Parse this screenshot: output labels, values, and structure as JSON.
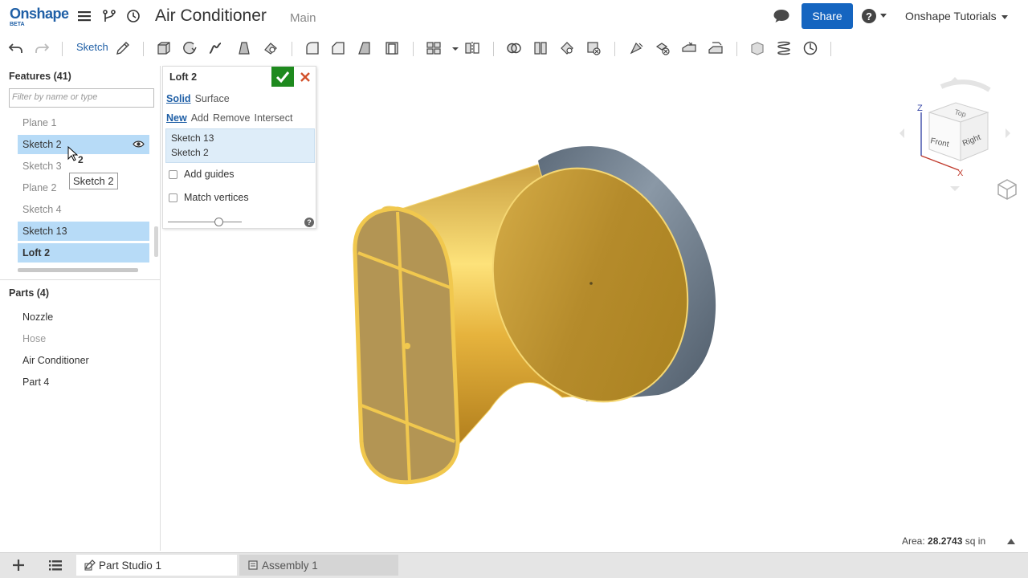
{
  "header": {
    "logo": "Onshape",
    "logo_badge": "BETA",
    "document_title": "Air Conditioner",
    "workspace": "Main",
    "share_label": "Share",
    "account_label": "Onshape Tutorials"
  },
  "toolbar": {
    "sketch_label": "Sketch"
  },
  "features": {
    "title": "Features (41)",
    "filter_placeholder": "Filter by name or type",
    "items": [
      {
        "label": "Plane 1"
      },
      {
        "label": "Sketch 2"
      },
      {
        "label": "Sketch 3"
      },
      {
        "label": "Plane 2"
      },
      {
        "label": "Sketch 4"
      },
      {
        "label": "Sketch 13"
      },
      {
        "label": "Loft 2"
      }
    ],
    "drag_count": "2",
    "tooltip": "Sketch 2"
  },
  "parts": {
    "title": "Parts (4)",
    "items": [
      {
        "label": "Nozzle"
      },
      {
        "label": "Hose"
      },
      {
        "label": "Air Conditioner"
      },
      {
        "label": "Part 4"
      }
    ]
  },
  "dialog": {
    "title": "Loft 2",
    "type_options": [
      "Solid",
      "Surface"
    ],
    "op_options": [
      "New",
      "Add",
      "Remove",
      "Intersect"
    ],
    "profiles": [
      "Sketch 13",
      "Sketch 2"
    ],
    "add_guides": "Add guides",
    "match_vertices": "Match vertices",
    "help": "?"
  },
  "viewcube": {
    "axis_z": "Z",
    "axis_x": "X",
    "face_top": "Top",
    "face_front": "Front",
    "face_right": "Right"
  },
  "status": {
    "area_label": "Area:",
    "area_value": "28.2743",
    "area_unit": "sq in"
  },
  "tabs": [
    {
      "label": "Part Studio 1"
    },
    {
      "label": "Assembly 1"
    }
  ],
  "colors": {
    "brand": "#1f5fa6",
    "share": "#1565c0",
    "selection": "#b7dbf7",
    "loft_gold": "#e8b23c",
    "body_gray": "#6a7888"
  }
}
